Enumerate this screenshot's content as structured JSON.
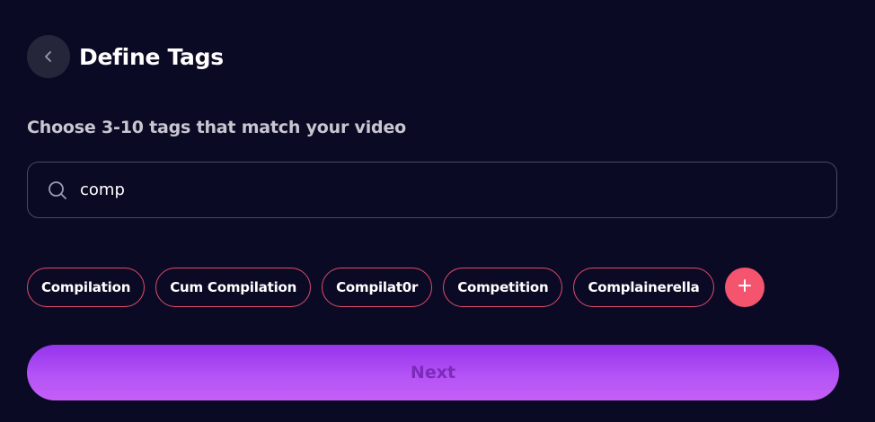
{
  "header": {
    "back_icon": "chevron-left-icon",
    "title": "Define Tags"
  },
  "subtitle": "Choose 3-10 tags that match your video",
  "search": {
    "icon": "search-icon",
    "value": "comp"
  },
  "tags": [
    {
      "label": "Compilation"
    },
    {
      "label": "Cum Compilation"
    },
    {
      "label": "Compilat0r"
    },
    {
      "label": "Competition"
    },
    {
      "label": "Complainerella"
    }
  ],
  "add_tag": {
    "icon": "plus-icon"
  },
  "next_button": {
    "label": "Next"
  },
  "colors": {
    "background": "#0b0a24",
    "tag_border": "#e04a6d",
    "add_button": "#f4546e",
    "next_gradient_start": "#9534ec",
    "next_gradient_end": "#c45ff7",
    "next_text": "#7c2bb8"
  }
}
